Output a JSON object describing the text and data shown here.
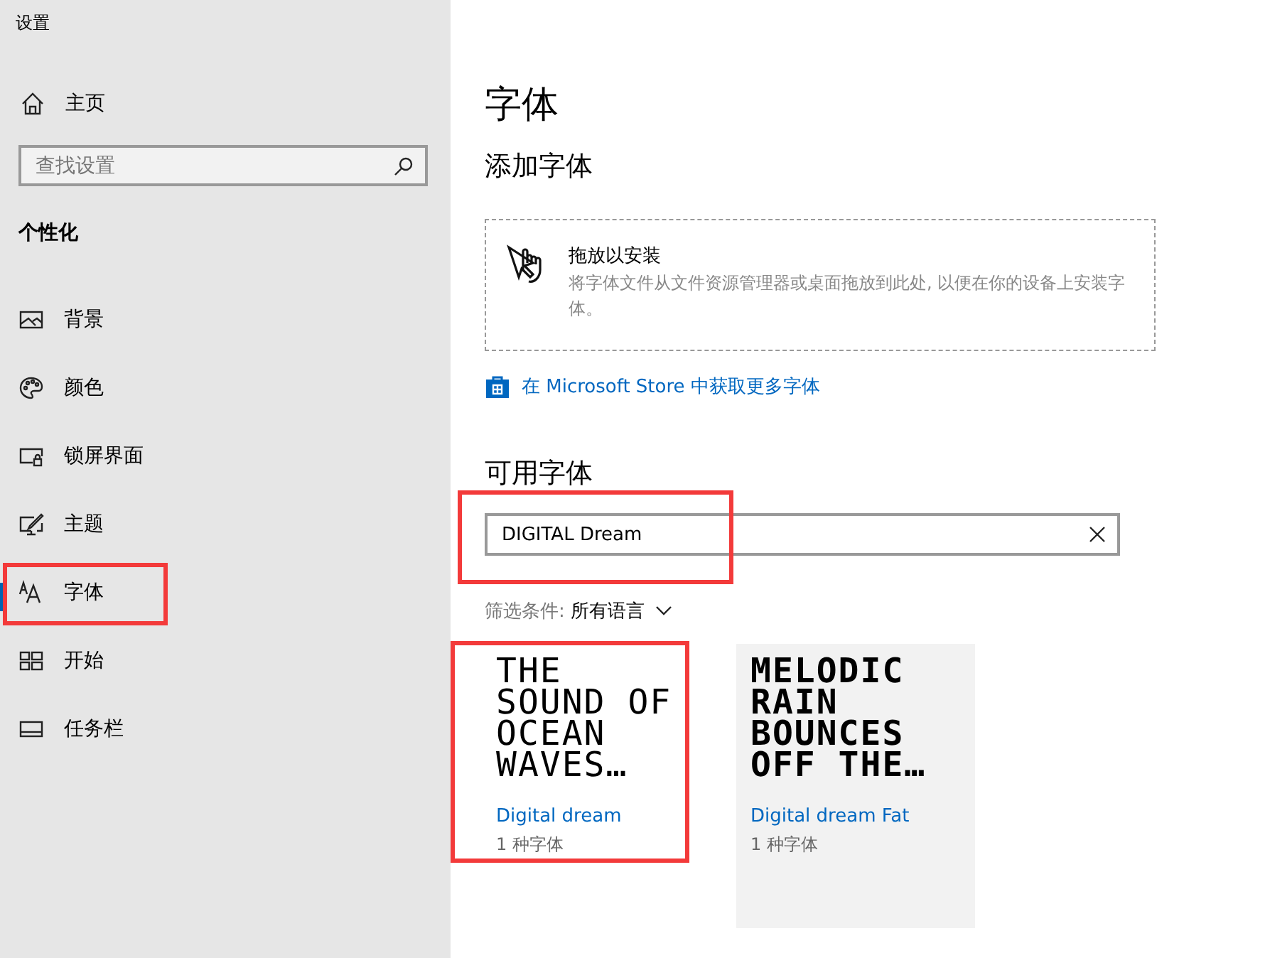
{
  "window": {
    "title": "设置"
  },
  "sidebar": {
    "home": {
      "label": "主页"
    },
    "search": {
      "placeholder": "查找设置"
    },
    "section": "个性化",
    "items": [
      {
        "label": "背景",
        "selected": false,
        "highlighted": false
      },
      {
        "label": "颜色",
        "selected": false,
        "highlighted": false
      },
      {
        "label": "锁屏界面",
        "selected": false,
        "highlighted": false
      },
      {
        "label": "主题",
        "selected": false,
        "highlighted": false
      },
      {
        "label": "字体",
        "selected": true,
        "highlighted": true
      },
      {
        "label": "开始",
        "selected": false,
        "highlighted": false
      },
      {
        "label": "任务栏",
        "selected": false,
        "highlighted": false
      }
    ]
  },
  "main": {
    "title": "字体",
    "add_heading": "添加字体",
    "drop_zone": {
      "title": "拖放以安装",
      "description": "将字体文件从文件资源管理器或桌面拖放到此处, 以便在你的设备上安装字体。"
    },
    "store_link": "在 Microsoft Store 中获取更多字体",
    "available_heading": "可用字体",
    "font_search": {
      "value": "DIGITAL Dream",
      "highlighted": true
    },
    "filter": {
      "label": "筛选条件:",
      "value": "所有语言"
    },
    "fonts": [
      {
        "preview": [
          "THE",
          "SOUND OF",
          "OCEAN",
          "WAVES…"
        ],
        "name": "Digital dream",
        "count": "1 种字体",
        "kind": "regular",
        "hovered": false,
        "highlighted": true
      },
      {
        "preview": [
          "MELODIC",
          "RAIN",
          "BOUNCES",
          "OFF THE…"
        ],
        "name": "Digital dream Fat",
        "count": "1 种字体",
        "kind": "bold",
        "hovered": true,
        "highlighted": false
      }
    ]
  }
}
